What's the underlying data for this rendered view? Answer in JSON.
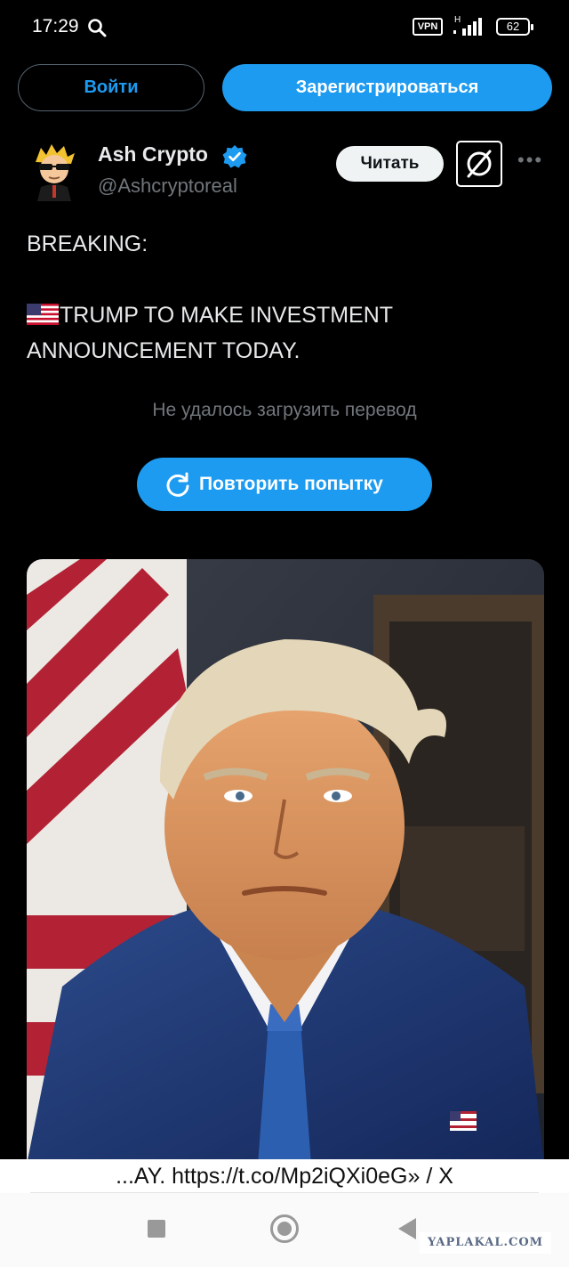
{
  "status_bar": {
    "time": "17:29",
    "vpn_label": "VPN",
    "network_label": "H",
    "battery": "62"
  },
  "auth": {
    "login_label": "Войти",
    "register_label": "Зарегистрироваться"
  },
  "tweet": {
    "author_name": "Ash Crypto",
    "author_handle": "@Ashcryptoreal",
    "follow_label": "Читать",
    "text_lines": [
      "BREAKING:",
      "",
      "TRUMP TO MAKE INVESTMENT",
      "ANNOUNCEMENT TODAY."
    ],
    "translation_error": "Не удалось загрузить перевод",
    "retry_label": "Повторить попытку"
  },
  "browser": {
    "url_title": "...AY. https://t.co/Mp2iQXi0eG» / X"
  },
  "watermark": "YAPLAKAL.COM",
  "colors": {
    "accent": "#1d9bf0",
    "background": "#000000",
    "text_primary": "#e7e9ea",
    "text_secondary": "#71767b"
  }
}
